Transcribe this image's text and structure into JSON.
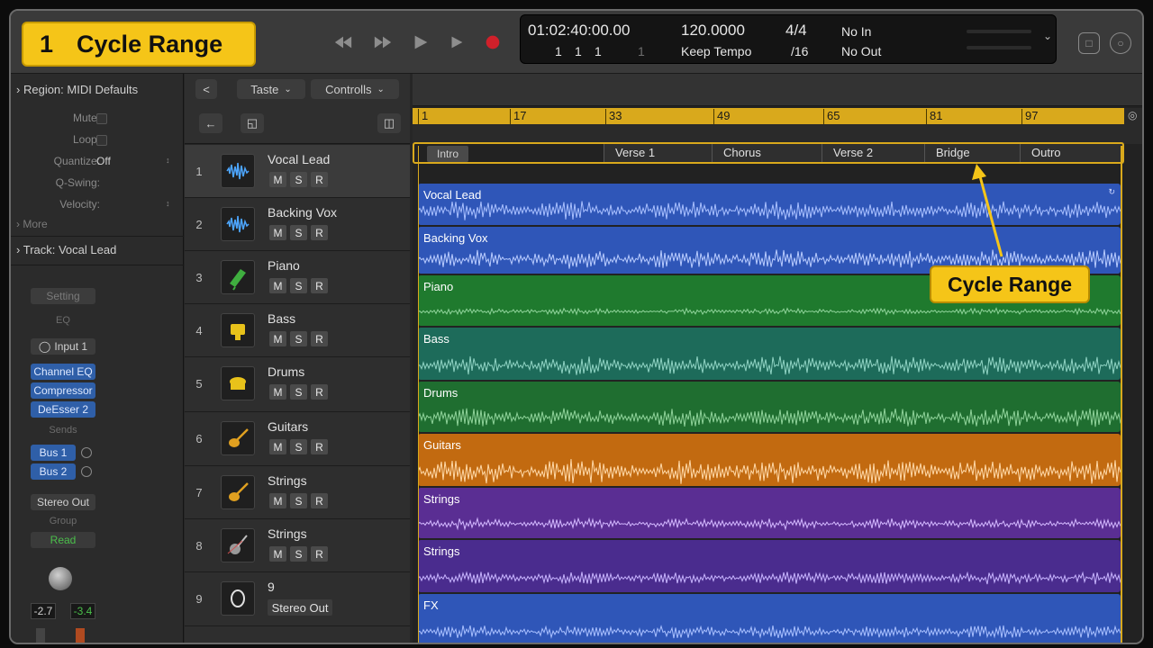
{
  "step": {
    "number": "1",
    "title": "Cycle Range"
  },
  "lcd": {
    "position": "01:02:40:00.00",
    "bars": [
      "1",
      "1",
      "1",
      "1"
    ],
    "tempo": "120.0000",
    "tempo_mode": "Keep Tempo",
    "signature": "4/4",
    "division": "/16",
    "in_label": "No In",
    "out_label": "No Out"
  },
  "inspector": {
    "region_header": "Region: MIDI Defaults",
    "mute_label": "Mute:",
    "loop_label": "Loop:",
    "quantize_label": "Quantize:",
    "quantize_value": "Off",
    "qswing_label": "Q-Swing:",
    "velocity_label": "Velocity:",
    "more_label": "More",
    "track_header": "Track: Vocal Lead",
    "setting": "Setting",
    "eq": "EQ",
    "input": "Input 1",
    "plugins": [
      "Channel EQ",
      "Compressor",
      "DeEsser 2"
    ],
    "sends_label": "Sends",
    "sends": [
      "Bus 1",
      "Bus 2"
    ],
    "output": "Stereo Out",
    "group": "Group",
    "automation": "Read",
    "volume": "-2.7",
    "peak": "-3.4"
  },
  "toolbar": {
    "back": "<",
    "edit_menu": "Taste",
    "controls_menu": "Controlls"
  },
  "tracks": [
    {
      "num": "1",
      "name": "Vocal Lead",
      "icon": "waveform-icon",
      "color": "#2f56b8"
    },
    {
      "num": "2",
      "name": "Backing Vox",
      "icon": "waveform-icon",
      "color": "#2f56b8"
    },
    {
      "num": "3",
      "name": "Piano",
      "icon": "piano-icon",
      "color": "#1f7a2e"
    },
    {
      "num": "4",
      "name": "Bass",
      "icon": "bass-amp-icon",
      "color": "#1d6b5a"
    },
    {
      "num": "5",
      "name": "Drums",
      "icon": "drums-icon",
      "color": "#1f6e30"
    },
    {
      "num": "6",
      "name": "Guitars",
      "icon": "guitar-icon",
      "color": "#c26a10"
    },
    {
      "num": "7",
      "name": "Strings",
      "icon": "guitar-icon",
      "color": "#5a2e93"
    },
    {
      "num": "8",
      "name": "Strings",
      "icon": "strings-icon",
      "color": "#4a2c8e"
    },
    {
      "num": "9",
      "name": "9",
      "icon": "output-icon",
      "color": "#2f56b8",
      "output": "Stereo Out"
    }
  ],
  "regions": [
    "Vocal Lead",
    "Backing Vox",
    "Piano",
    "Bass",
    "Drums",
    "Guitars",
    "Strings",
    "Strings",
    "FX"
  ],
  "msr": {
    "m": "M",
    "s": "S",
    "r": "R"
  },
  "ruler": {
    "bars": [
      "1",
      "17",
      "33",
      "49",
      "65",
      "81",
      "97"
    ]
  },
  "markers": {
    "intro": "Intro",
    "sections": [
      "Verse 1",
      "Chorus",
      "Verse 2",
      "Bridge",
      "Outro"
    ]
  },
  "annotation": {
    "label": "Cycle Range"
  },
  "colors": {
    "accent_yellow": "#f5c518",
    "cycle_yellow": "#d9a91c",
    "record_red": "#d0202a",
    "selected_blue": "#2f5fa8"
  }
}
